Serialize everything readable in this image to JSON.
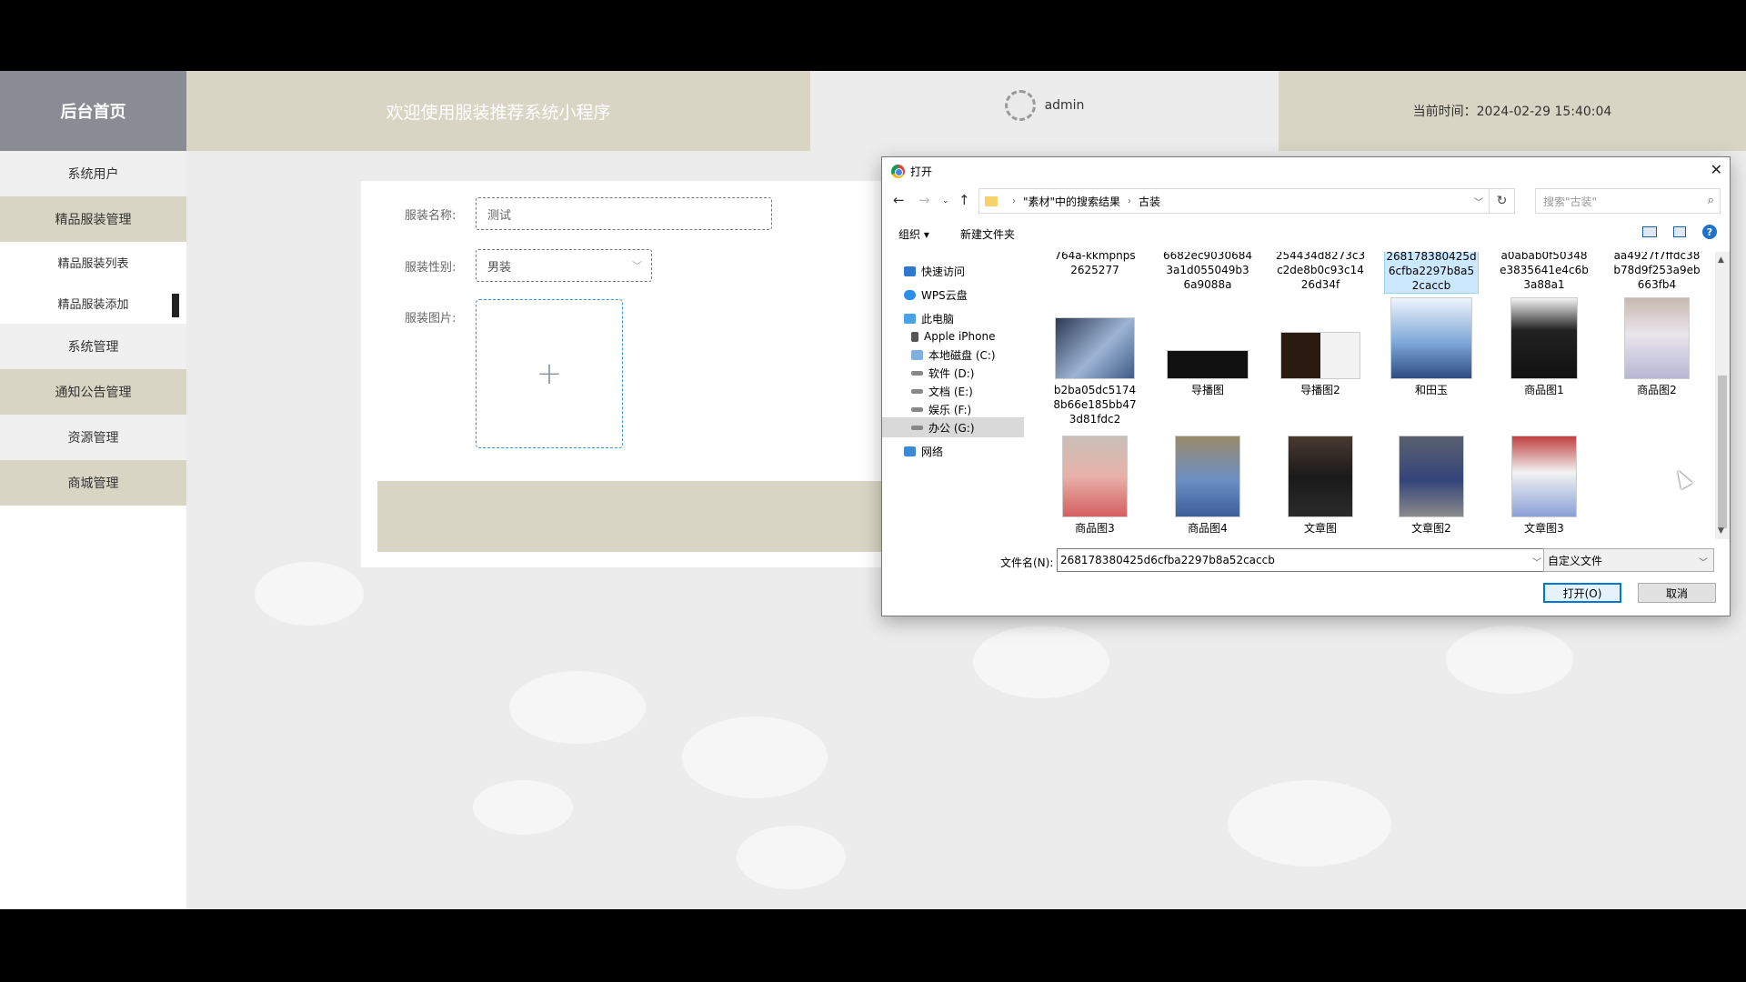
{
  "header": {
    "logo": "后台首页",
    "welcome": "欢迎使用服装推荐系统小程序",
    "username": "admin",
    "time": "当前时间：2024-02-29 15:40:04"
  },
  "sidebar": {
    "items": [
      {
        "label": "系统用户"
      },
      {
        "label": "精品服装管理"
      },
      {
        "label": "精品服装列表"
      },
      {
        "label": "精品服装添加"
      },
      {
        "label": "系统管理"
      },
      {
        "label": "通知公告管理"
      },
      {
        "label": "资源管理"
      },
      {
        "label": "商城管理"
      }
    ]
  },
  "form": {
    "name_label": "服装名称:",
    "name_value": "测试",
    "gender_label": "服装性别:",
    "gender_value": "男装",
    "image_label": "服装图片:",
    "upload_plus": "+"
  },
  "dialog": {
    "title": "打开",
    "breadcrumb_1": "\"素材\"中的搜索结果",
    "breadcrumb_2": "古装",
    "search_placeholder": "搜索\"古装\"",
    "organize": "组织 ▾",
    "new_folder": "新建文件夹",
    "nav": [
      {
        "label": "快速访问"
      },
      {
        "label": "WPS云盘"
      },
      {
        "label": "此电脑"
      },
      {
        "label": "Apple iPhone"
      },
      {
        "label": "本地磁盘 (C:)"
      },
      {
        "label": "软件 (D:)"
      },
      {
        "label": "文档 (E:)"
      },
      {
        "label": "娱乐 (F:)"
      },
      {
        "label": "办公 (G:)"
      },
      {
        "label": "网络"
      }
    ],
    "top_files": [
      {
        "name": "764a-kkmpnps\n2625277"
      },
      {
        "name": "6682ec9030684\n3a1d055049b3\n6a9088a"
      },
      {
        "name": "254434d8273c3\nc2de8b0c93c14\n26d34f"
      },
      {
        "name": "268178380425d\n6cfba2297b8a5\n2caccb"
      },
      {
        "name": "a0abab0f50348\ne3835641e4c6b\n3a88a1"
      },
      {
        "name": "aa4927f7ffdc38\nb78d9f253a9eb\n663fb4"
      }
    ],
    "row1": [
      {
        "name": "b2ba05dc5174\n8b66e185bb47\n3d81fdc2"
      },
      {
        "name": "导播图"
      },
      {
        "name": "导播图2"
      },
      {
        "name": "和田玉"
      },
      {
        "name": "商品图1"
      },
      {
        "name": "商品图2"
      }
    ],
    "row2": [
      {
        "name": "商品图3"
      },
      {
        "name": "商品图4"
      },
      {
        "name": "文章图"
      },
      {
        "name": "文章图2"
      },
      {
        "name": "文章图3"
      }
    ],
    "filename_label": "文件名(N):",
    "filename_value": "268178380425d6cfba2297b8a52caccb",
    "filetype": "自定义文件",
    "open_btn": "打开(O)",
    "cancel_btn": "取消"
  },
  "colors": {
    "beige": "#d8d5c4",
    "logo_bg": "#8a8c93",
    "upload_border": "#3b8fe0"
  }
}
